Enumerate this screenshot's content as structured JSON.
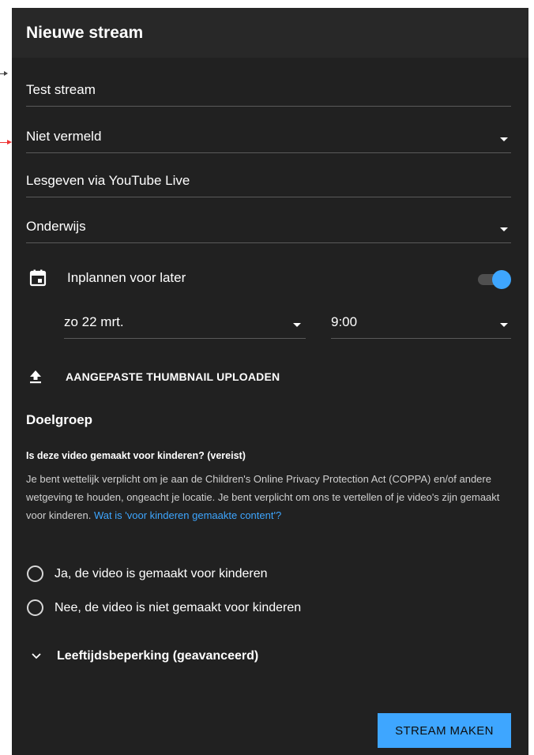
{
  "dialog": {
    "title": "Nieuwe stream"
  },
  "fields": {
    "title_value": "Test stream",
    "visibility_value": "Niet vermeld",
    "description_value": "Lesgeven via YouTube Live",
    "category_value": "Onderwijs"
  },
  "schedule": {
    "label": "Inplannen voor later",
    "enabled": true,
    "date_value": "zo 22 mrt.",
    "time_value": "9:00"
  },
  "thumbnail": {
    "upload_label": "AANGEPASTE THUMBNAIL UPLOADEN"
  },
  "audience": {
    "section_title": "Doelgroep",
    "question": "Is deze video gemaakt voor kinderen? (vereist)",
    "description": "Je bent wettelijk verplicht om je aan de Children's Online Privacy Protection Act (COPPA) en/of andere wetgeving te houden, ongeacht je locatie. Je bent verplicht om ons te vertellen of je video's zijn gemaakt voor kinderen.",
    "link_text": "Wat is 'voor kinderen gemaakte content'?",
    "option_yes": "Ja, de video is gemaakt voor kinderen",
    "option_no": "Nee, de video is niet gemaakt voor kinderen"
  },
  "age_restriction": {
    "label": "Leeftijdsbeperking (geavanceerd)"
  },
  "actions": {
    "create_label": "STREAM MAKEN"
  },
  "colors": {
    "accent": "#3ea6ff",
    "background": "#212121",
    "header": "#282828"
  }
}
